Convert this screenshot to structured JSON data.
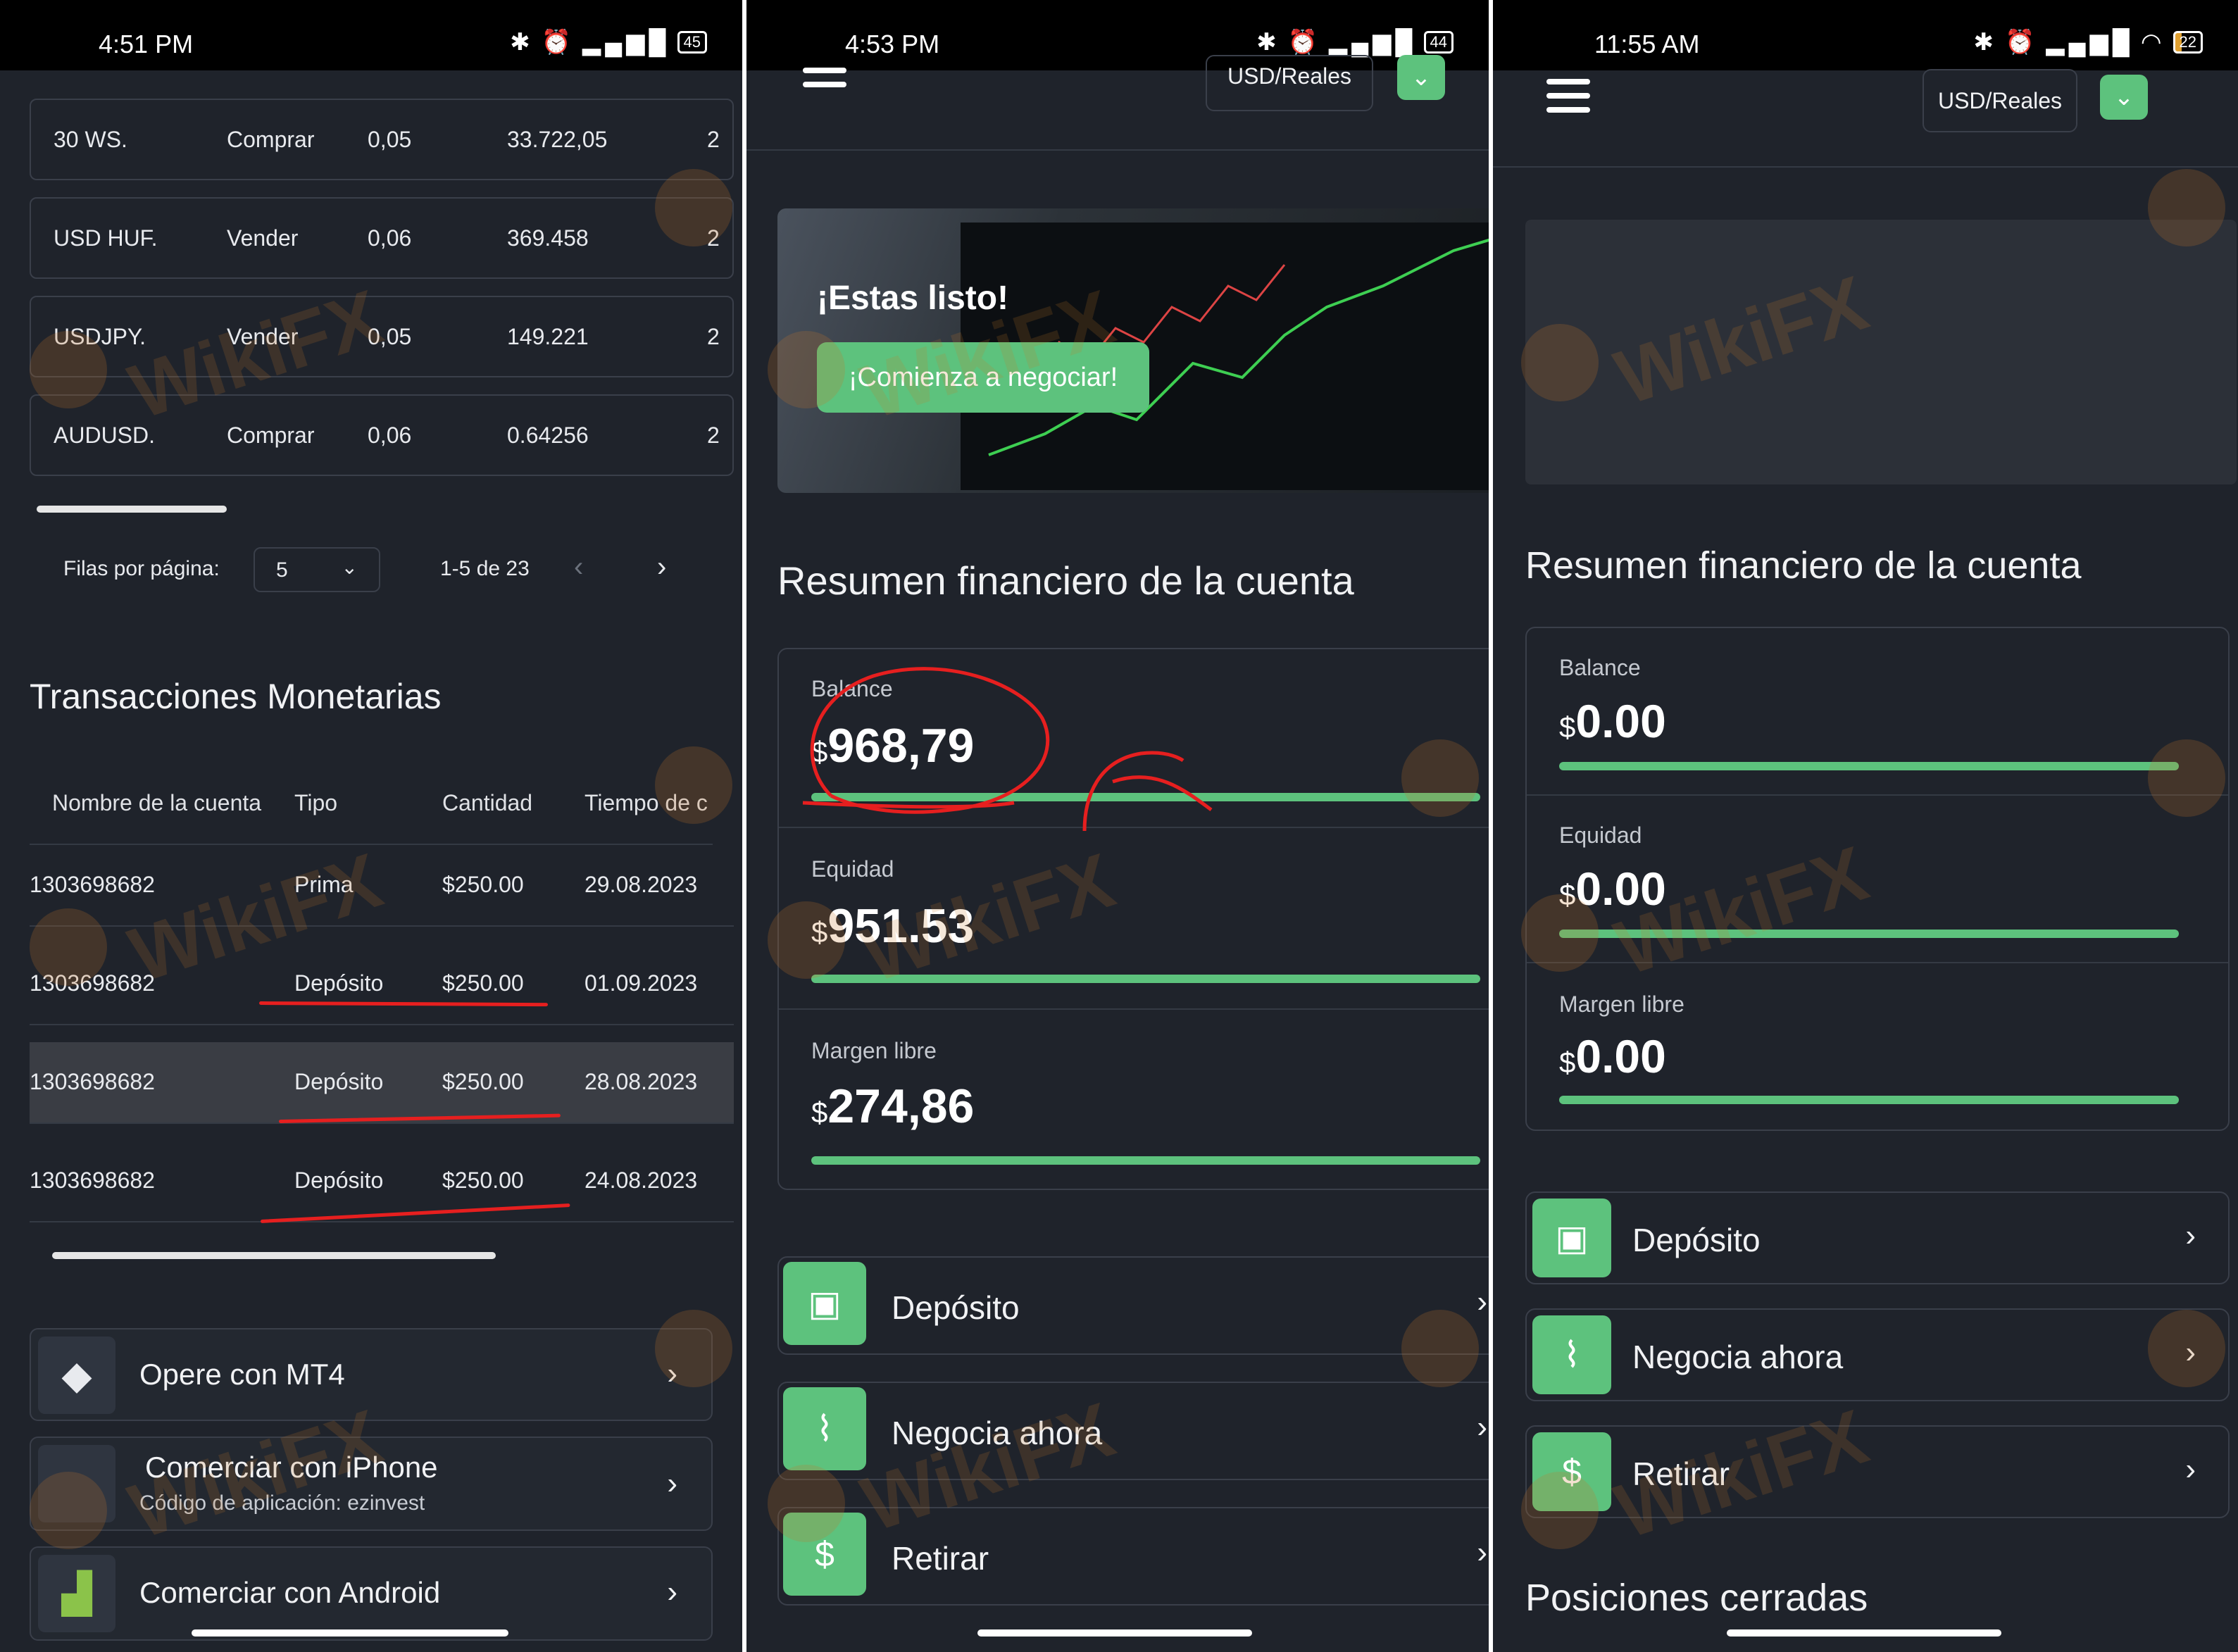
{
  "panel1": {
    "status_time": "4:51 PM",
    "battery": "45",
    "trades": [
      {
        "symbol": "30 WS.",
        "type": "Comprar",
        "lot": "0,05",
        "price": "33.722,05",
        "more": "2"
      },
      {
        "symbol": "USD HUF.",
        "type": "Vender",
        "lot": "0,06",
        "price": "369.458",
        "more": "2"
      },
      {
        "symbol": "USDJPY.",
        "type": "Vender",
        "lot": "0,05",
        "price": "149.221",
        "more": "2"
      },
      {
        "symbol": "AUDUSD.",
        "type": "Comprar",
        "lot": "0,06",
        "price": "0.64256",
        "more": "2"
      }
    ],
    "rows_per_page_label": "Filas por página:",
    "rows_per_page_value": "5",
    "page_range": "1-5 de 23",
    "transactions_title": "Transacciones Monetarias",
    "tx_headers": [
      "Nombre de la cuenta",
      "Tipo",
      "Cantidad",
      "Tiempo de c"
    ],
    "transactions": [
      {
        "account": "1303698682",
        "type": "Prima",
        "amount": "$250.00",
        "date": "29.08.2023"
      },
      {
        "account": "1303698682",
        "type": "Depósito",
        "amount": "$250.00",
        "date": "01.09.2023"
      },
      {
        "account": "1303698682",
        "type": "Depósito",
        "amount": "$250.00",
        "date": "28.08.2023"
      },
      {
        "account": "1303698682",
        "type": "Depósito",
        "amount": "$250.00",
        "date": "24.08.2023"
      }
    ],
    "apps": [
      {
        "label": "Opere con MT4",
        "sub": ""
      },
      {
        "label": "Comerciar con iPhone",
        "sub": "Código de aplicación: ezinvest"
      },
      {
        "label": "Comerciar con Android",
        "sub": ""
      }
    ]
  },
  "panel2": {
    "status_time": "4:53 PM",
    "battery": "44",
    "currency": "USD/Reales",
    "banner_title": "¡Estas listo!",
    "banner_cta": "¡Comienza a negociar!",
    "summary_title": "Resumen financiero de la cuenta",
    "balance_label": "Balance",
    "balance_value": "968,79",
    "equity_label": "Equidad",
    "equity_value": "951.53",
    "margin_label": "Margen libre",
    "margin_value": "274,86",
    "actions": [
      "Depósito",
      "Negocia ahora",
      "Retirar"
    ]
  },
  "panel3": {
    "status_time": "11:55 AM",
    "battery": "22",
    "currency": "USD/Reales",
    "summary_title": "Resumen financiero de la cuenta",
    "balance_label": "Balance",
    "balance_value": "0.00",
    "equity_label": "Equidad",
    "equity_value": "0.00",
    "margin_label": "Margen libre",
    "margin_value": "0.00",
    "actions": [
      "Depósito",
      "Negocia ahora",
      "Retirar"
    ],
    "closed_positions_title": "Posiciones cerradas"
  },
  "currency_symbol": "$",
  "watermark_text": "WikiFX",
  "colors": {
    "accent": "#5dc27d",
    "background": "#1f232b",
    "annotation": "#e61f1f"
  }
}
